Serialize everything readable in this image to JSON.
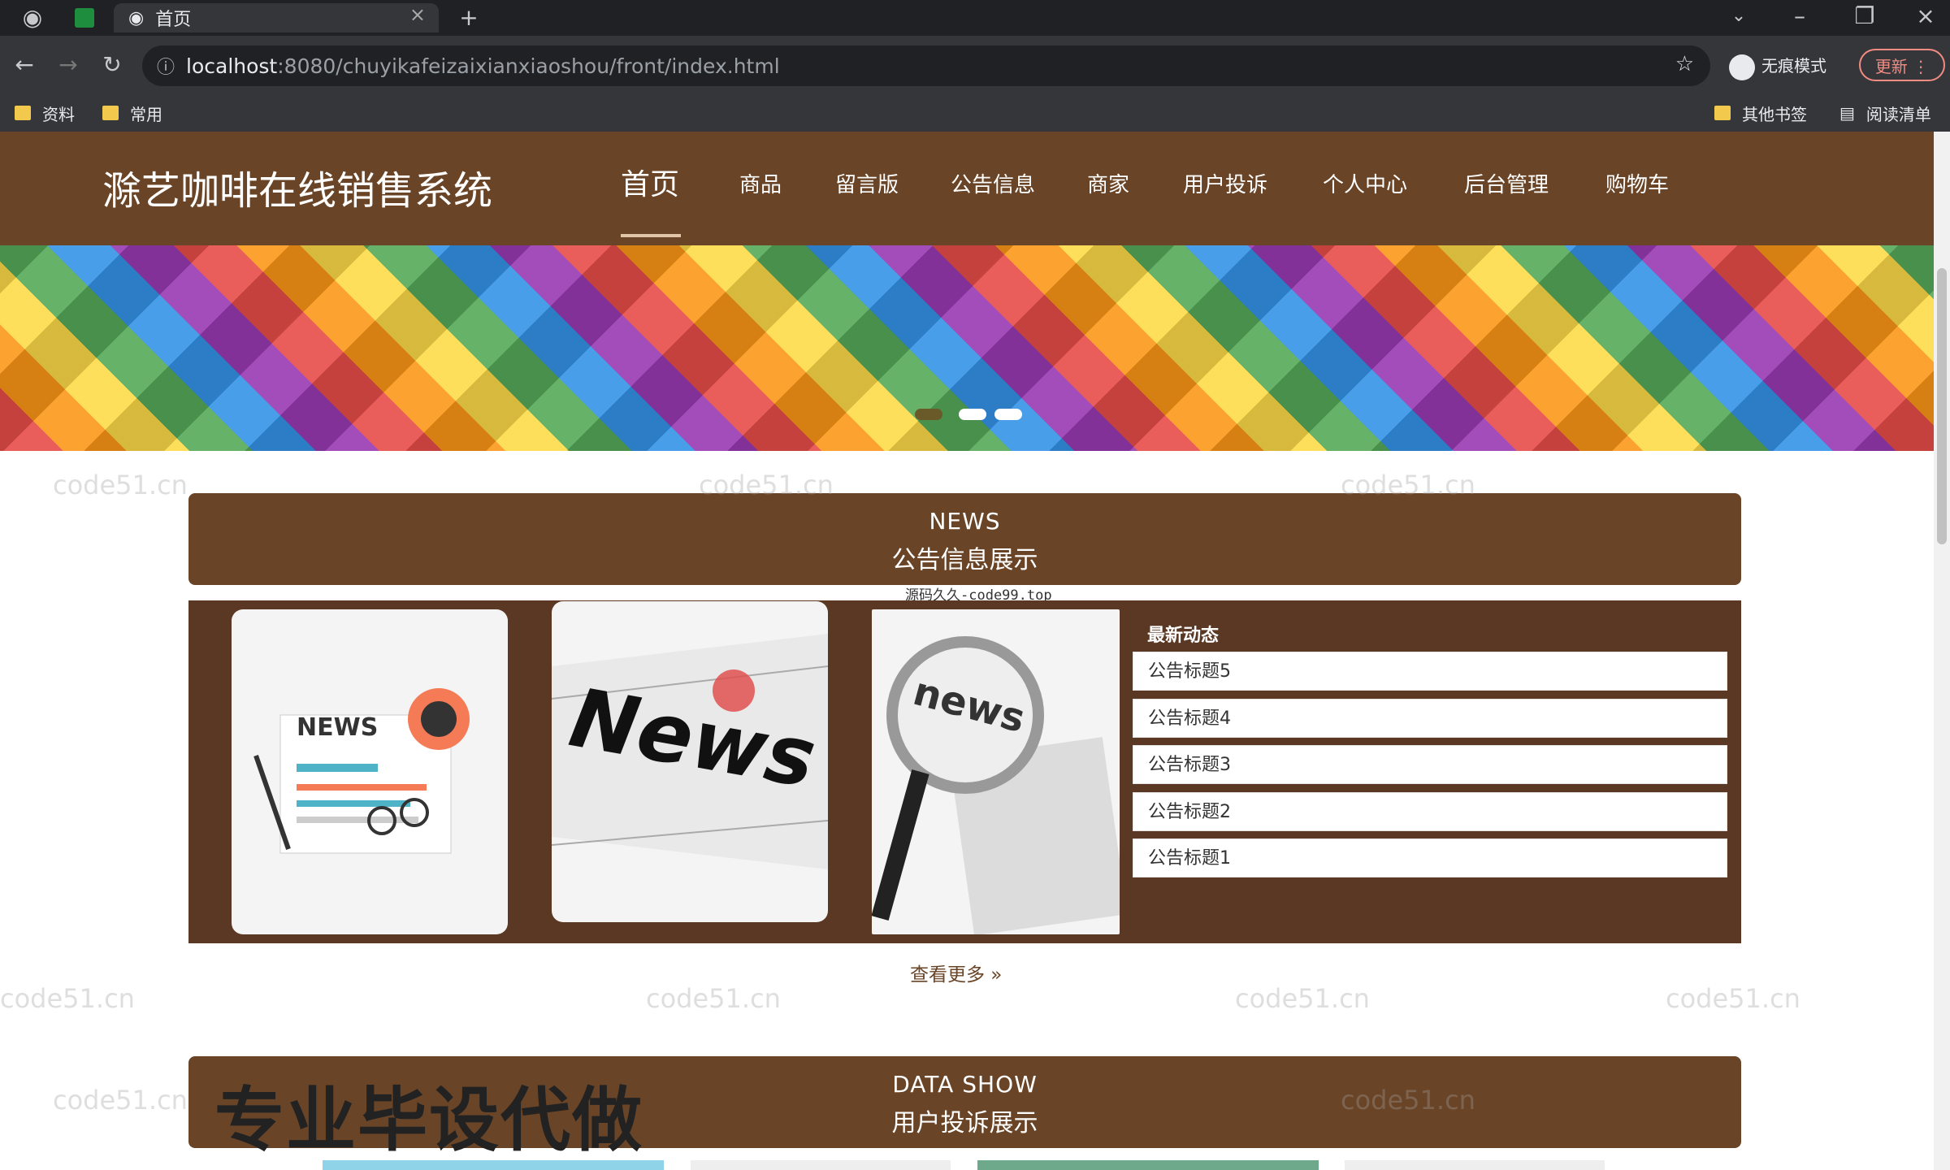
{
  "browser": {
    "tab_title": "首页",
    "url_host": "localhost",
    "url_rest": ":8080/chuyikafeizaixianxiaoshou/front/index.html",
    "incognito_label": "无痕模式",
    "update_label": "更新",
    "bookmarks": [
      "资料",
      "常用"
    ],
    "other_bookmarks": "其他书签",
    "reading_list": "阅读清单"
  },
  "site": {
    "title": "滁艺咖啡在线销售系统",
    "nav": [
      "首页",
      "商品",
      "留言版",
      "公告信息",
      "商家",
      "用户投诉",
      "个人中心",
      "后台管理",
      "购物车"
    ],
    "active_nav_index": 0
  },
  "news_section": {
    "en_title": "NEWS",
    "cn_title": "公告信息展示",
    "source_note": "源码久久-code99.top",
    "list_title": "最新动态",
    "items": [
      "公告标题5",
      "公告标题4",
      "公告标题3",
      "公告标题2",
      "公告标题1"
    ],
    "card_texts": [
      "NEWS",
      "News",
      "news"
    ],
    "see_more": "查看更多 »"
  },
  "data_section": {
    "en_title": "DATA SHOW",
    "cn_title": "用户投诉展示",
    "promo": "专业毕设代做"
  },
  "watermark": "code51.cn",
  "colors": {
    "brand": "#6a4426",
    "panel": "#5a3823",
    "browser_dark": "#1f2125"
  }
}
